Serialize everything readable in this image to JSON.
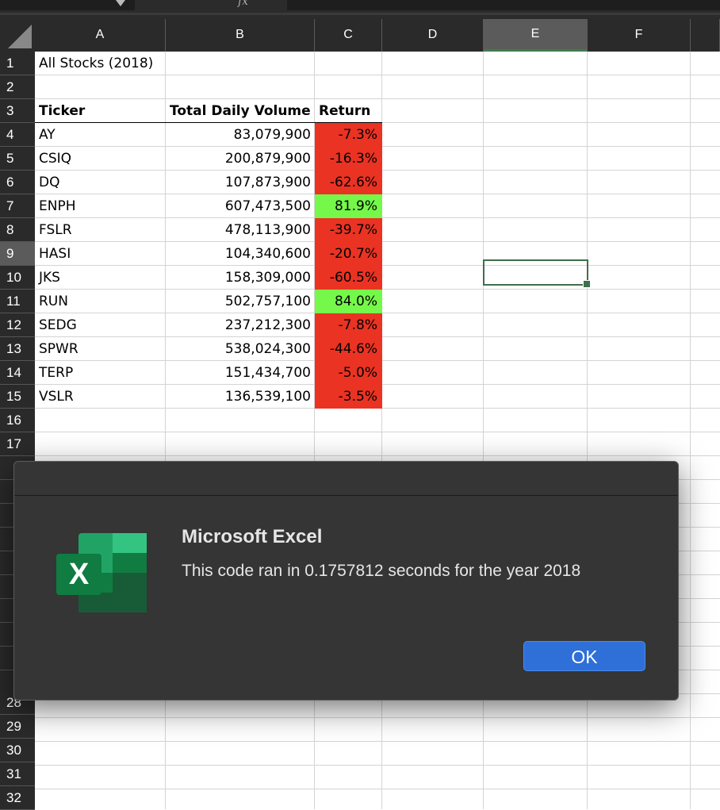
{
  "formula_bar": {
    "fx_label": "fx"
  },
  "columns": [
    "A",
    "B",
    "C",
    "D",
    "E",
    "F"
  ],
  "selected_column": "E",
  "rows_top": [
    "1",
    "2",
    "3",
    "4",
    "5",
    "6",
    "7",
    "8",
    "9",
    "10",
    "11",
    "12",
    "13",
    "14",
    "15",
    "16",
    "17"
  ],
  "rows_bottom": [
    "28",
    "29",
    "30",
    "31",
    "32"
  ],
  "selected_row": "9",
  "sheet": {
    "title": "All Stocks (2018)",
    "headers": {
      "ticker": "Ticker",
      "volume": "Total Daily Volume",
      "return": "Return"
    },
    "stocks": [
      {
        "ticker": "AY",
        "volume": "83,079,900",
        "return": "-7.3%",
        "status": "neg"
      },
      {
        "ticker": "CSIQ",
        "volume": "200,879,900",
        "return": "-16.3%",
        "status": "neg"
      },
      {
        "ticker": "DQ",
        "volume": "107,873,900",
        "return": "-62.6%",
        "status": "neg"
      },
      {
        "ticker": "ENPH",
        "volume": "607,473,500",
        "return": "81.9%",
        "status": "pos"
      },
      {
        "ticker": "FSLR",
        "volume": "478,113,900",
        "return": "-39.7%",
        "status": "neg"
      },
      {
        "ticker": "HASI",
        "volume": "104,340,600",
        "return": "-20.7%",
        "status": "neg"
      },
      {
        "ticker": "JKS",
        "volume": "158,309,000",
        "return": "-60.5%",
        "status": "neg"
      },
      {
        "ticker": "RUN",
        "volume": "502,757,100",
        "return": "84.0%",
        "status": "pos"
      },
      {
        "ticker": "SEDG",
        "volume": "237,212,300",
        "return": "-7.8%",
        "status": "neg"
      },
      {
        "ticker": "SPWR",
        "volume": "538,024,300",
        "return": "-44.6%",
        "status": "neg"
      },
      {
        "ticker": "TERP",
        "volume": "151,434,700",
        "return": "-5.0%",
        "status": "neg"
      },
      {
        "ticker": "VSLR",
        "volume": "136,539,100",
        "return": "-3.5%",
        "status": "neg"
      }
    ]
  },
  "colors": {
    "negative": "#ea3323",
    "positive": "#75f84a",
    "accent": "#2f6fd8"
  },
  "dialog": {
    "title": "Microsoft Excel",
    "message": "This code ran in 0.1757812 seconds for the year 2018",
    "ok_label": "OK",
    "icon": "excel-app-icon",
    "icon_letter": "X"
  }
}
